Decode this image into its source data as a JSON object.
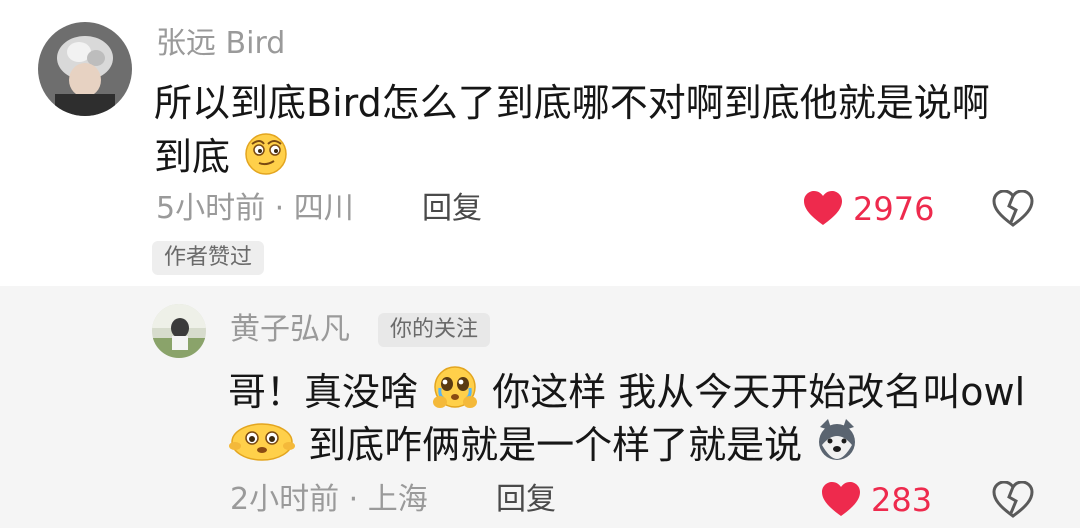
{
  "comment": {
    "username": "张远 Bird",
    "text_line1": "所以到底Bird怎么了到底哪不对啊到底他就是说啊",
    "text_line2": "到底",
    "meta_time_location": "5小时前 · 四川",
    "reply_label": "回复",
    "like_count": "2976",
    "author_liked_badge": "作者赞过",
    "emoji_after_line2": "smirk-face-icon"
  },
  "reply": {
    "username": "黄子弘凡",
    "follow_badge": "你的关注",
    "text_line1_part1": "哥！真没啥",
    "text_line1_part2": "你这样 我从今天开始改名叫owl",
    "text_line2": "到底咋俩就是一个样了就是说",
    "meta_time_location": "2小时前 · 上海",
    "reply_label": "回复",
    "like_count": "283",
    "emoji_after_part1": "pleading-face-icon",
    "emoji_line2_start": "shy-eyes-face-icon",
    "emoji_line2_end": "husky-dog-icon"
  },
  "colors": {
    "heart": "#ee2a4d",
    "like_text": "#ee2a4d",
    "muted": "#9a9a9a",
    "text": "#161616"
  }
}
